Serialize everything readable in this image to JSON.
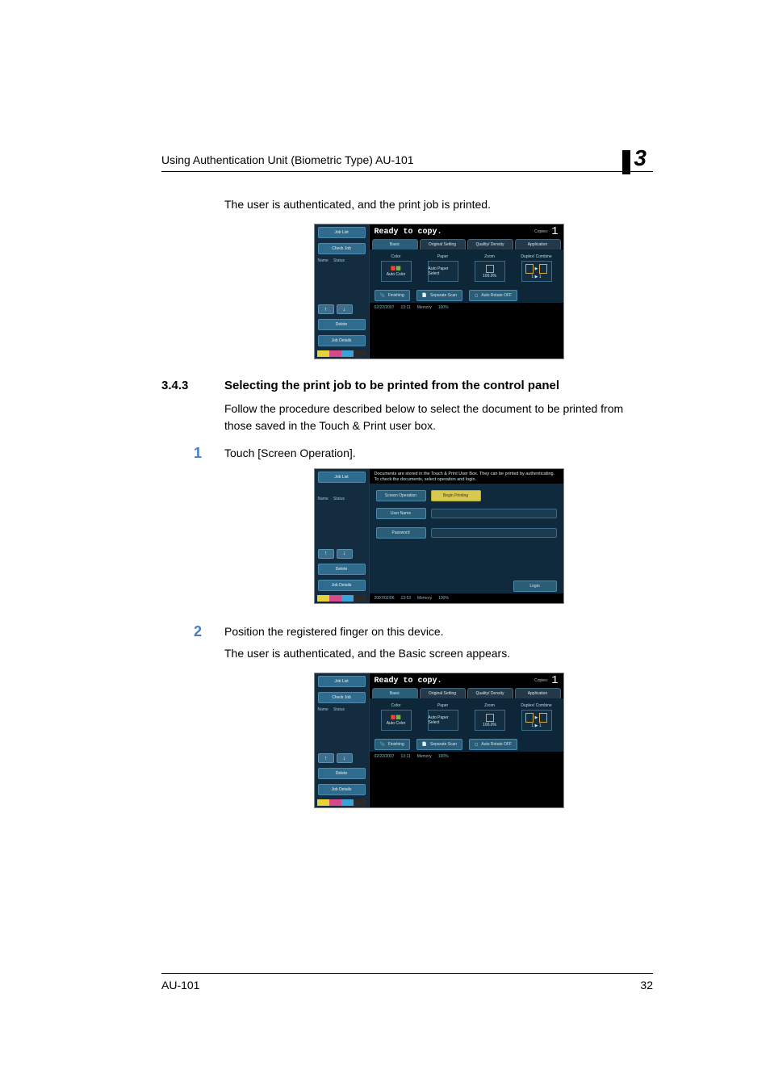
{
  "header": {
    "title": "Using Authentication Unit (Biometric Type) AU-101",
    "chapter": "3"
  },
  "intro_para": "The user is authenticated, and the print job is printed.",
  "section": {
    "number": "3.4.3",
    "title": "Selecting the print job to be printed from the control panel",
    "lead": "Follow the procedure described below to select the document to be printed from those saved in the Touch & Print user box."
  },
  "steps": {
    "s1_num": "1",
    "s1_text": "Touch [Screen Operation].",
    "s2_num": "2",
    "s2_text": "Position the registered finger on this device.",
    "s2_sub": "The user is authenticated, and the Basic screen appears."
  },
  "copy_panel": {
    "job_list": "Job List",
    "check_job": "Check Job",
    "name": "Name",
    "status": "Status",
    "delete": "Delete",
    "job_details": "Job Details",
    "ready": "Ready to copy.",
    "copies_label": "Copies:",
    "copies_value": "1",
    "tabs": {
      "basic": "Basic",
      "orig": "Original Setting",
      "quality": "Quality/\nDensity",
      "app": "Application"
    },
    "opts": {
      "color": "Color",
      "color_val": "Auto Color",
      "paper": "Paper",
      "paper_val": "Auto Paper\nSelect",
      "zoom": "Zoom",
      "zoom_val": "100.0%",
      "duplex": "Duplex/\nCombine",
      "duplex_val": "1 ▶ 1"
    },
    "low": {
      "finishing": "Finishing",
      "separate": "Separate Scan",
      "auto_rotate": "Auto Rotate OFF"
    },
    "footer": {
      "date1": "02/22/2007",
      "time1": "13:11",
      "memory": "Memory",
      "memval": "100%"
    }
  },
  "auth_panel": {
    "job_list": "Job List",
    "name": "Name",
    "status": "Status",
    "delete": "Delete",
    "job_details": "Job Details",
    "msg": "Documents are stored in the Touch & Print User Box. They can be printed by authenticating. To check the documents, select operation and login.",
    "screen_op": "Screen\nOperation",
    "begin_print": "Begin Printing",
    "user_name": "User Name",
    "password": "Password",
    "login": "Login",
    "footer": {
      "date": "2007/02/06",
      "time": "13:53",
      "memory": "Memory",
      "memval": "100%"
    }
  },
  "footer": {
    "model": "AU-101",
    "page": "32"
  }
}
